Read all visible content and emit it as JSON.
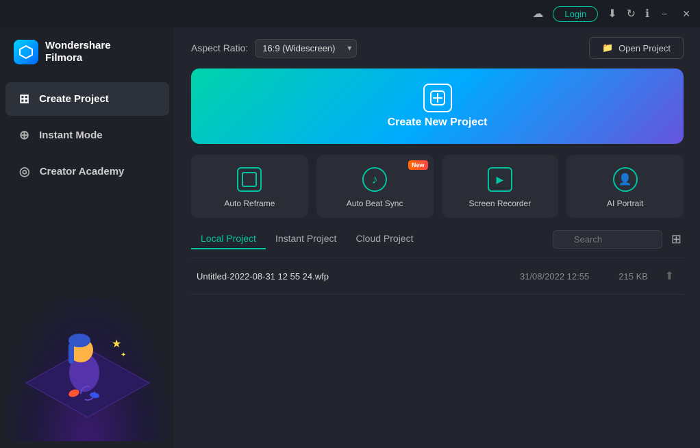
{
  "titlebar": {
    "login_label": "Login",
    "minimize": "−",
    "close": "✕"
  },
  "sidebar": {
    "logo_line1": "Wondershare",
    "logo_line2": "Filmora",
    "items": [
      {
        "id": "create-project",
        "label": "Create Project",
        "icon": "⊞",
        "active": true
      },
      {
        "id": "instant-mode",
        "label": "Instant Mode",
        "icon": "⊕",
        "active": false
      },
      {
        "id": "creator-academy",
        "label": "Creator Academy",
        "icon": "◎",
        "active": false
      }
    ]
  },
  "topbar": {
    "aspect_ratio_label": "Aspect Ratio:",
    "aspect_ratio_value": "16:9 (Widescreen)",
    "open_project_label": "Open Project"
  },
  "create_banner": {
    "label": "Create New Project"
  },
  "quick_actions": [
    {
      "id": "auto-reframe",
      "label": "Auto Reframe",
      "icon": "reframe",
      "new": false
    },
    {
      "id": "auto-beat-sync",
      "label": "Auto Beat Sync",
      "icon": "beat",
      "new": true
    },
    {
      "id": "screen-recorder",
      "label": "Screen Recorder",
      "icon": "screen",
      "new": false
    },
    {
      "id": "ai-portrait",
      "label": "AI Portrait",
      "icon": "portrait",
      "new": false
    }
  ],
  "new_badge_label": "New",
  "projects": {
    "tabs": [
      {
        "id": "local",
        "label": "Local Project",
        "active": true
      },
      {
        "id": "instant",
        "label": "Instant Project",
        "active": false
      },
      {
        "id": "cloud",
        "label": "Cloud Project",
        "active": false
      }
    ],
    "search_placeholder": "Search",
    "rows": [
      {
        "name": "Untitled-2022-08-31 12 55 24.wfp",
        "date": "31/08/2022 12:55",
        "size": "215 KB"
      }
    ]
  }
}
